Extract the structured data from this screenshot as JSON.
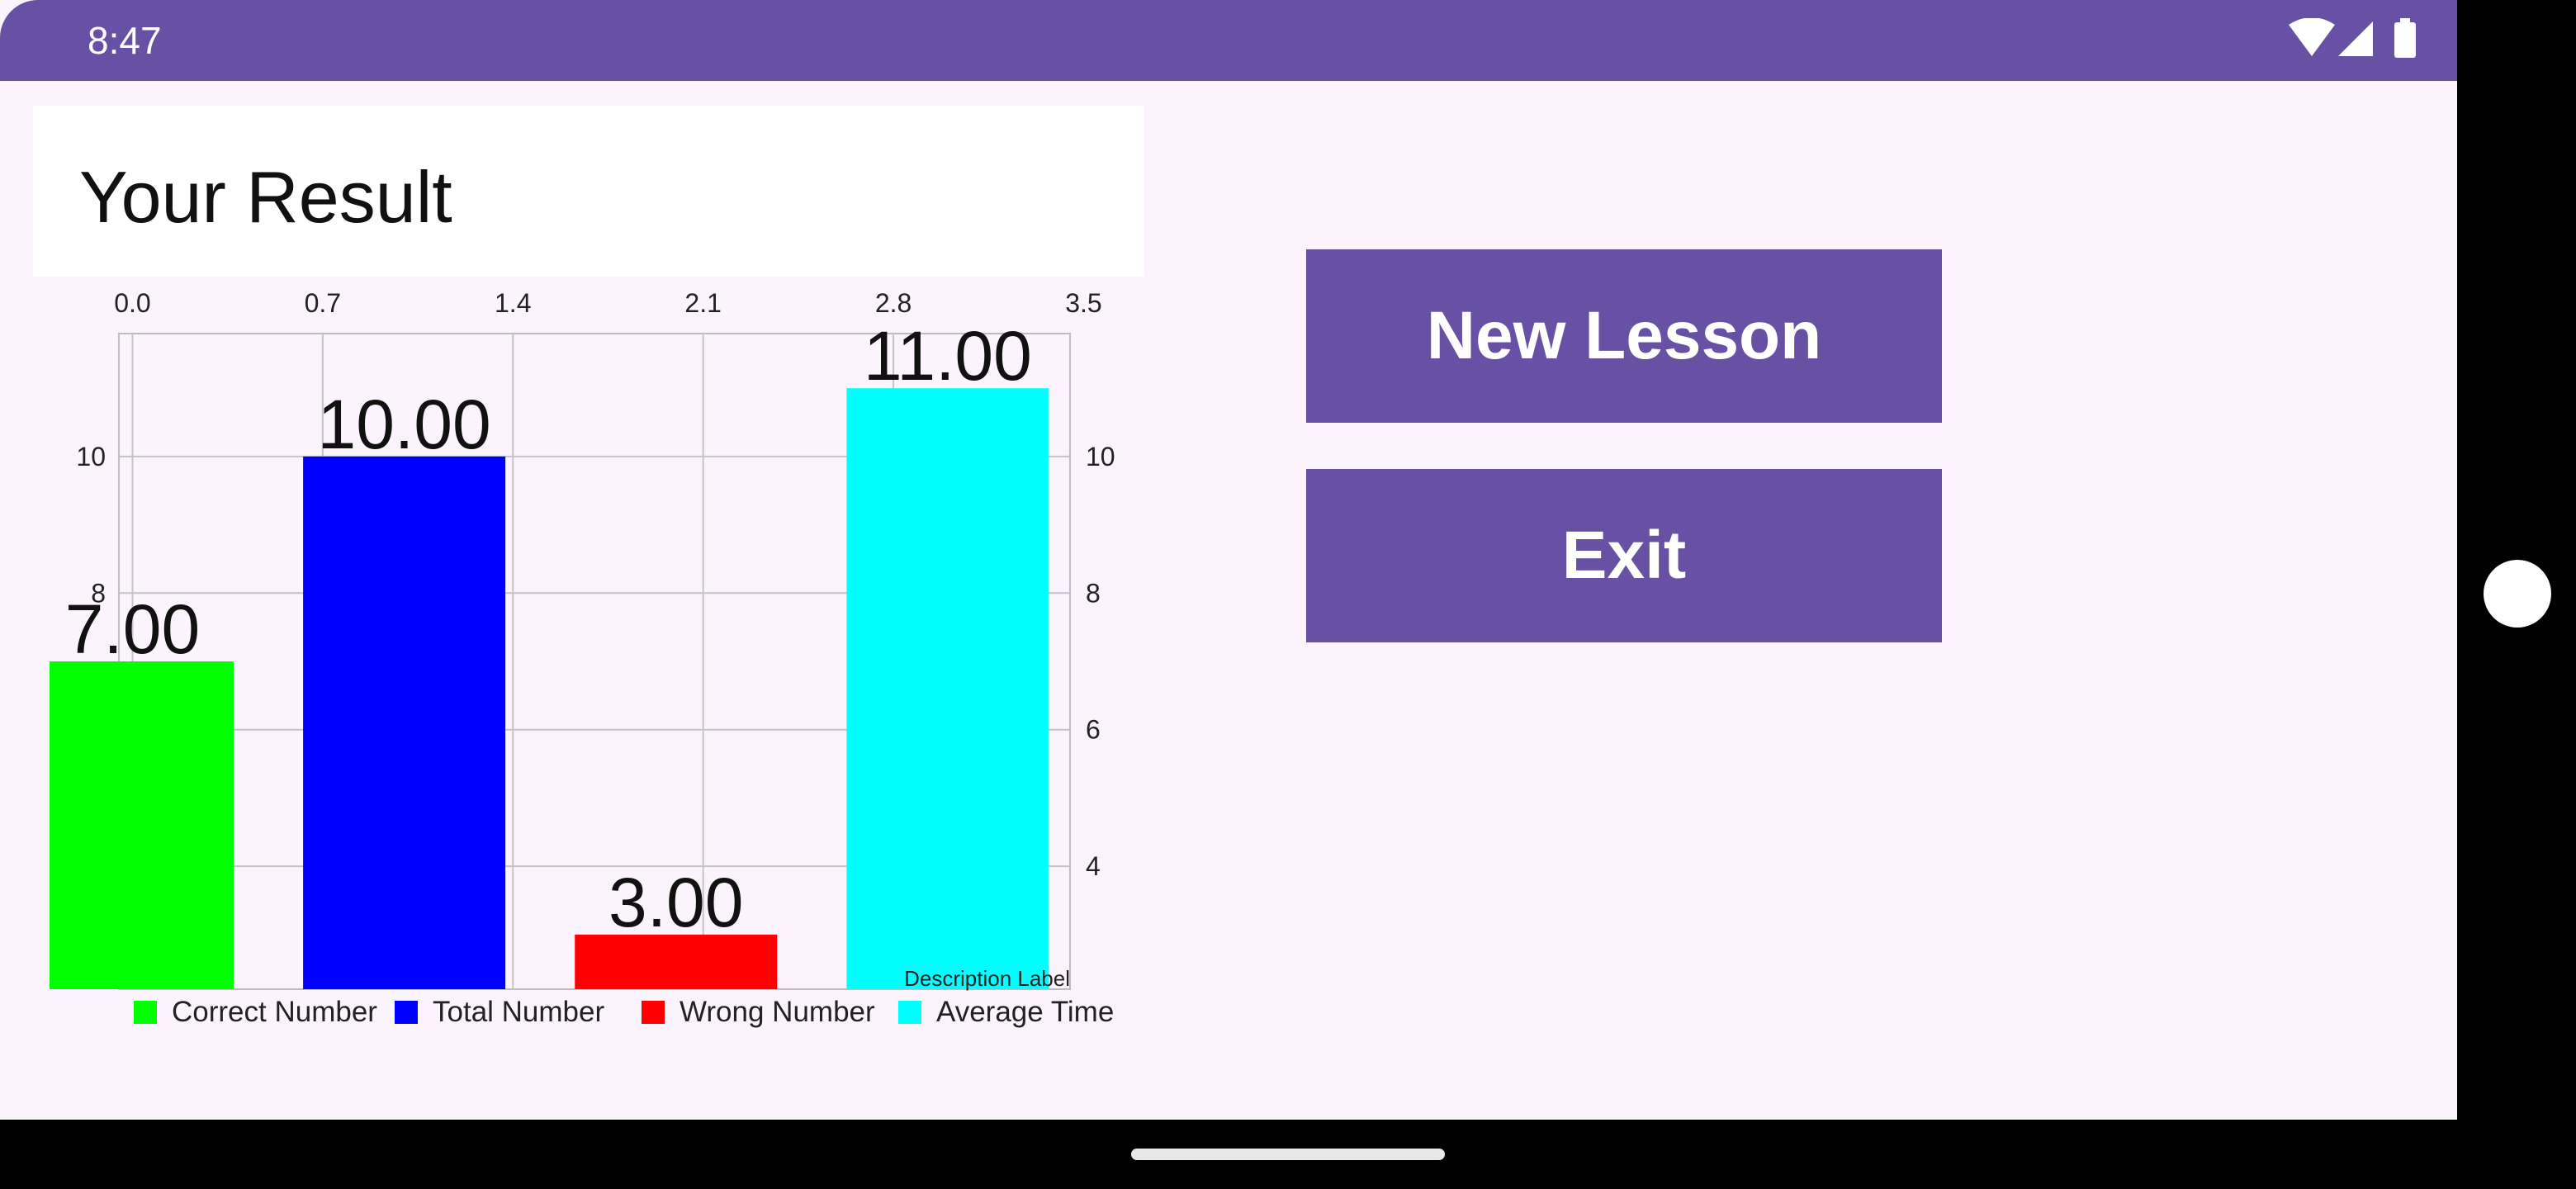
{
  "status_bar": {
    "time": "8:47",
    "icons": [
      "wifi-icon",
      "cellular-signal-icon",
      "battery-icon"
    ]
  },
  "title_card": {
    "title": "Your Result"
  },
  "chart_data": {
    "type": "bar",
    "categories": [
      "Correct Number",
      "Total Number",
      "Wrong Number",
      "Average Time"
    ],
    "values": [
      7,
      10,
      3,
      11
    ],
    "value_labels": [
      "7.00",
      "10.00",
      "3.00",
      "11.00"
    ],
    "colors": [
      "#00ff00",
      "#0000ff",
      "#ff0000",
      "#00ffff"
    ],
    "x_ticks": [
      "0.0",
      "0.7",
      "1.4",
      "2.1",
      "2.8",
      "3.5"
    ],
    "x_range": [
      -0.05,
      3.45
    ],
    "y_ticks": [
      4,
      6,
      8,
      10
    ],
    "y_range": [
      2.2,
      11.8
    ],
    "description": "Description Label",
    "grid": true,
    "legend_position": "bottom"
  },
  "buttons": {
    "new_lesson": "New Lesson",
    "exit": "Exit"
  }
}
